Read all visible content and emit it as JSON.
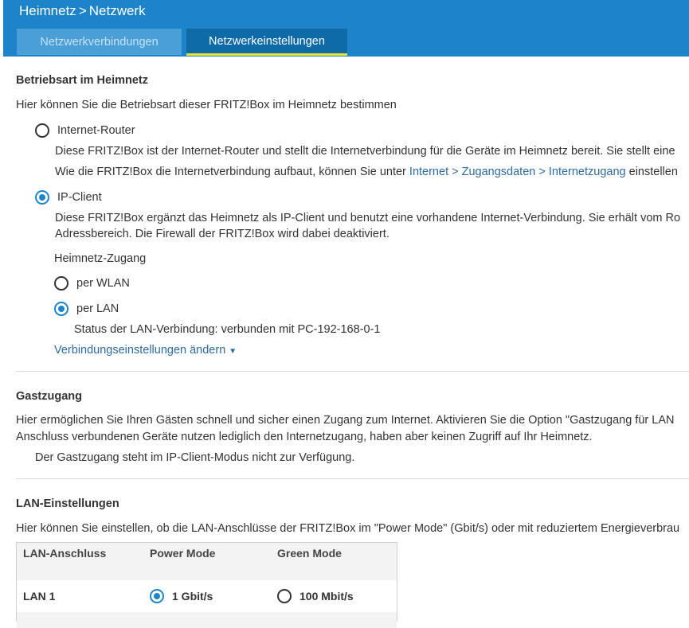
{
  "header": {
    "crumb_root": "Heimnetz",
    "crumb_sep": ">",
    "crumb_page": "Netzwerk",
    "tabs": [
      {
        "label": "Netzwerkverbindungen",
        "active": false
      },
      {
        "label": "Netzwerkeinstellungen",
        "active": true
      }
    ]
  },
  "betriebsart": {
    "heading": "Betriebsart im Heimnetz",
    "intro": "Hier können Sie die Betriebsart dieser FRITZ!Box im Heimnetz bestimmen",
    "router_label": "Internet-Router",
    "router_desc": "Diese FRITZ!Box ist der Internet-Router und stellt die Internetverbindung für die Geräte im Heimnetz bereit. Sie stellt eine",
    "router_desc2_pre": "Wie die FRITZ!Box die Internetverbindung aufbaut, können Sie unter",
    "router_link": "Internet > Zugangsdaten > Internetzugang",
    "router_desc2_post": "einstellen",
    "ipclient_label": "IP-Client",
    "ipclient_desc1": "Diese FRITZ!Box ergänzt das Heimnetz als IP-Client und benutzt eine vorhandene Internet-Verbindung. Sie erhält vom Ro",
    "ipclient_desc2": "Adressbereich. Die Firewall der FRITZ!Box wird dabei deaktiviert.",
    "zugang_label": "Heimnetz-Zugang",
    "wlan_label": "per WLAN",
    "lan_label": "per LAN",
    "lan_status": "Status der LAN-Verbindung: verbunden mit PC-192-168-0-1",
    "change_link": "Verbindungseinstellungen ändern",
    "caret": "▼",
    "selected_mode": "IP-Client",
    "selected_access": "per LAN"
  },
  "gast": {
    "heading": "Gastzugang",
    "desc1": "Hier ermöglichen Sie Ihren Gästen schnell und sicher einen Zugang zum Internet. Aktivieren Sie die Option \"Gastzugang für LAN",
    "desc2": "Anschluss verbundenen Geräte nutzen lediglich den Internetzugang, haben aber keinen Zugriff auf Ihr Heimnetz.",
    "note": "Der Gastzugang steht im IP-Client-Modus nicht zur Verfügung."
  },
  "lan": {
    "heading": "LAN-Einstellungen",
    "desc": "Hier können Sie einstellen, ob die LAN-Anschlüsse der FRITZ!Box im \"Power Mode\" (Gbit/s) oder mit reduziertem Energieverbrau",
    "columns": [
      "LAN-Anschluss",
      "Power Mode",
      "Green Mode"
    ],
    "rows": [
      {
        "port": "LAN 1",
        "power": "1 Gbit/s",
        "green": "100 Mbit/s",
        "selected": "power"
      }
    ]
  },
  "colors": {
    "accent": "#1d84c9",
    "tab_underline": "#e9e233",
    "link": "#2d6aa3"
  }
}
